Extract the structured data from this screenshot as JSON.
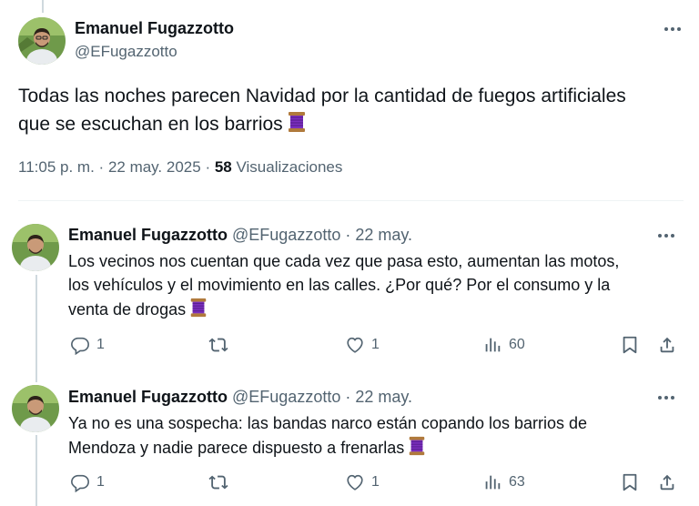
{
  "author": {
    "name": "Emanuel Fugazzotto",
    "handle": "@EFugazzotto"
  },
  "main_tweet": {
    "text_line1": "Todas las noches parecen Navidad por la cantidad de fuegos artificiales",
    "text_line2": "que se escuchan en los barrios",
    "emoji": "thread-spool",
    "time": "11:05 p. m.",
    "separator": "·",
    "date": "22 may. 2025",
    "views_count": "58",
    "views_label": "Visualizaciones"
  },
  "replies": [
    {
      "name": "Emanuel Fugazzotto",
      "handle": "@EFugazzotto",
      "date": "· 22 may.",
      "lines": [
        "Los vecinos nos cuentan que cada vez que pasa esto, aumentan las motos,",
        "los vehículos y el movimiento en las calles. ¿Por qué? Por el consumo y la",
        "venta de drogas"
      ],
      "replies_count": "1",
      "reposts_count": "",
      "likes_count": "1",
      "views_count": "60"
    },
    {
      "name": "Emanuel Fugazzotto",
      "handle": "@EFugazzotto",
      "date": "· 22 may.",
      "lines": [
        "Ya no es una sospecha: las bandas narco están copando los barrios de",
        "Mendoza y nadie parece dispuesto a frenarlas"
      ],
      "replies_count": "1",
      "reposts_count": "",
      "likes_count": "1",
      "views_count": "63"
    }
  ],
  "icons": {
    "more": "more-horizontal-icon",
    "reply": "reply-icon",
    "repost": "repost-icon",
    "like": "like-icon",
    "views": "views-icon",
    "bookmark": "bookmark-icon",
    "share": "share-icon"
  },
  "colors": {
    "text": "#0f1419",
    "secondary": "#536471",
    "divider": "#eff3f4",
    "thread_line": "#cfd9de",
    "spool": "#7b2fbe"
  }
}
